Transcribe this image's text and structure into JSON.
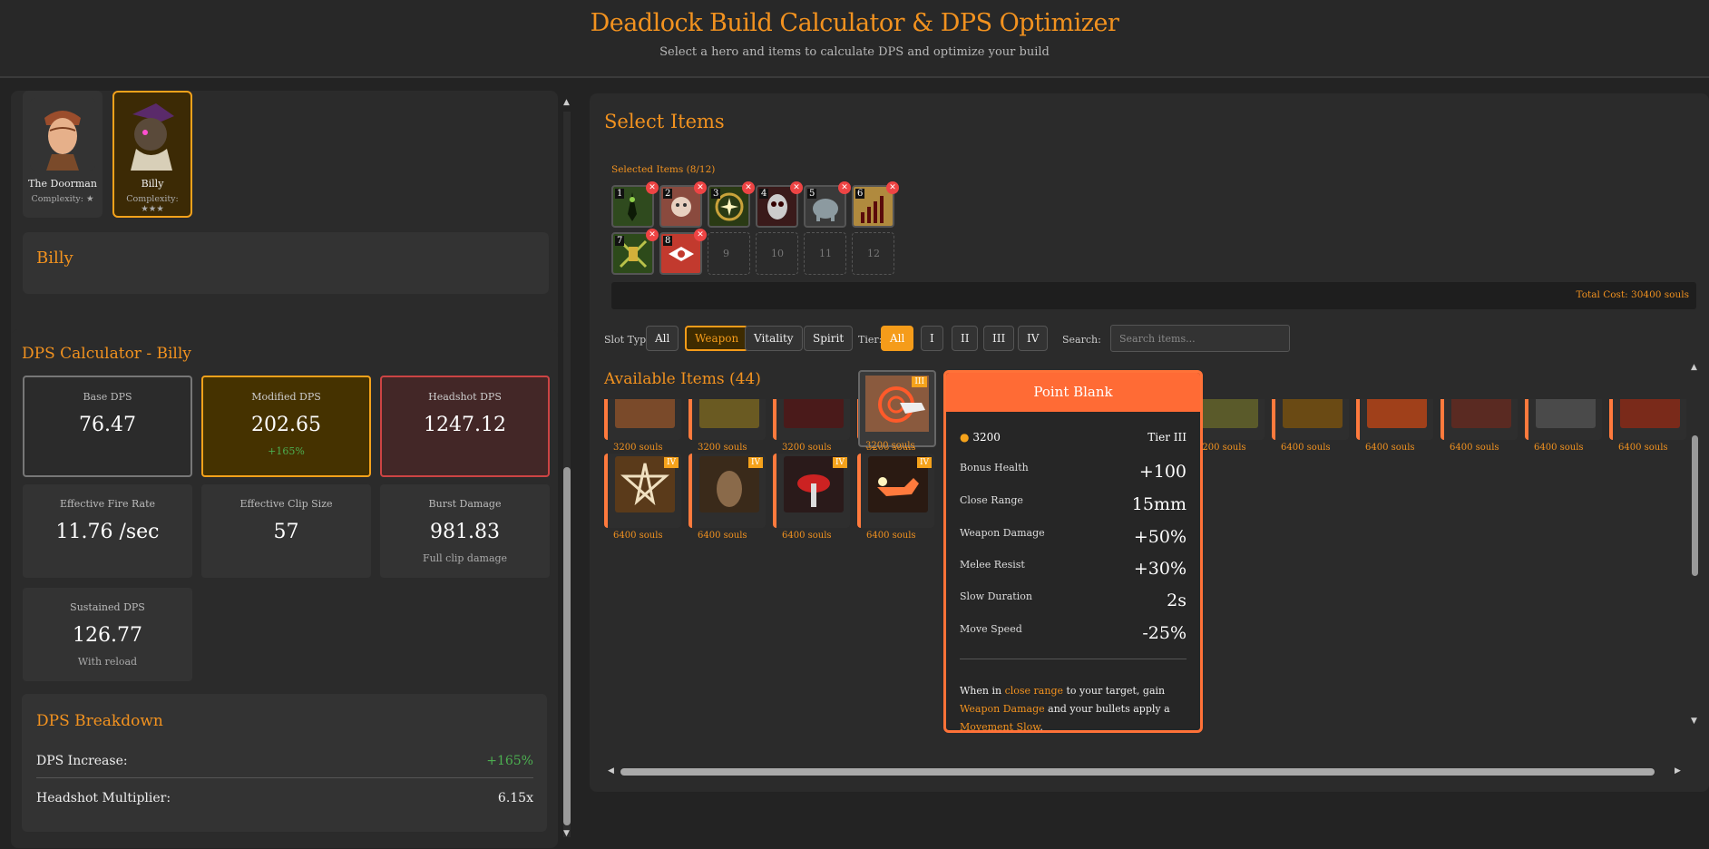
{
  "header": {
    "title": "Deadlock Build Calculator & DPS Optimizer",
    "subtitle": "Select a hero and items to calculate DPS and optimize your build"
  },
  "heroes": [
    {
      "name": "The Doorman",
      "complexity": "Complexity: ★"
    },
    {
      "name": "Billy",
      "complexity": "Complexity: ★★★"
    }
  ],
  "hero_detail": {
    "name": "Billy"
  },
  "dps": {
    "title": "DPS Calculator - Billy",
    "base": {
      "label": "Base DPS",
      "value": "76.47"
    },
    "modified": {
      "label": "Modified DPS",
      "value": "202.65",
      "change": "+165%"
    },
    "headshot": {
      "label": "Headshot DPS",
      "value": "1247.12"
    },
    "fire_rate": {
      "label": "Effective Fire Rate",
      "value": "11.76 /sec"
    },
    "clip": {
      "label": "Effective Clip Size",
      "value": "57"
    },
    "burst": {
      "label": "Burst Damage",
      "value": "981.83",
      "sub": "Full clip damage"
    },
    "sustained": {
      "label": "Sustained DPS",
      "value": "126.77",
      "sub": "With reload"
    }
  },
  "breakdown": {
    "title": "DPS Breakdown",
    "rows": [
      {
        "label": "DPS Increase:",
        "value": "+165%"
      },
      {
        "label": "Headshot Multiplier:",
        "value": "6.15x"
      }
    ]
  },
  "select_items": {
    "title": "Select Items",
    "selected_label": "Selected Items (8/12)",
    "slots": [
      "1",
      "2",
      "3",
      "4",
      "5",
      "6",
      "7",
      "8",
      "9",
      "10",
      "11",
      "12"
    ],
    "total_cost": "Total Cost: 30400 souls"
  },
  "filters": {
    "slot_label": "Slot Type:",
    "slot_options": [
      "All",
      "Weapon",
      "Vitality",
      "Spirit"
    ],
    "tier_label": "Tier:",
    "tier_options": [
      "All",
      "I",
      "II",
      "III",
      "IV"
    ],
    "search_label": "Search:",
    "search_placeholder": "Search items..."
  },
  "available": {
    "title": "Available Items (44)",
    "row1_costs": [
      "3200 souls",
      "3200 souls",
      "3200 souls",
      "3200 souls",
      "3200 souls",
      "6400 souls",
      "6400 souls",
      "6400 souls",
      "6400 souls",
      "6400 souls"
    ],
    "row2": [
      {
        "cost": "6400 souls",
        "tier": "IV"
      },
      {
        "cost": "6400 souls",
        "tier": "IV"
      },
      {
        "cost": "6400 souls",
        "tier": "IV"
      },
      {
        "cost": "6400 souls",
        "tier": "IV"
      }
    ],
    "hover_tier": "III"
  },
  "tooltip": {
    "name": "Point Blank",
    "cost": "3200",
    "tier": "Tier III",
    "stats": [
      {
        "label": "Bonus Health",
        "value": "+100"
      },
      {
        "label": "Close Range",
        "value": "15mm"
      },
      {
        "label": "Weapon Damage",
        "value": "+50%"
      },
      {
        "label": "Melee Resist",
        "value": "+30%"
      },
      {
        "label": "Slow Duration",
        "value": "2s"
      },
      {
        "label": "Move Speed",
        "value": "-25%"
      }
    ],
    "desc": {
      "p1": "When in ",
      "h1": "close range",
      "p2": " to your target, gain ",
      "h2": "Weapon Damage",
      "p3": " and your bullets apply a ",
      "h3": "Movement Slow",
      "p4": "."
    }
  },
  "colors": {
    "accent": "#f2921f",
    "item_border": "#ff7a3d",
    "tooltip_header": "#ff6b35"
  }
}
